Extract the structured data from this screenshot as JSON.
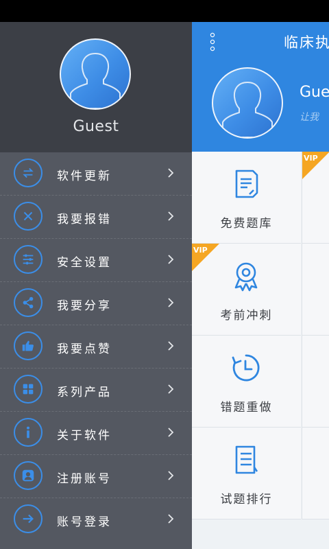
{
  "drawer": {
    "user_name": "Guest",
    "items": [
      {
        "label": "软件更新",
        "icon": "refresh-arrows-icon"
      },
      {
        "label": "我要报错",
        "icon": "close-icon"
      },
      {
        "label": "安全设置",
        "icon": "sliders-icon"
      },
      {
        "label": "我要分享",
        "icon": "share-icon"
      },
      {
        "label": "我要点赞",
        "icon": "thumbs-up-icon"
      },
      {
        "label": "系列产品",
        "icon": "grid-icon"
      },
      {
        "label": "关于软件",
        "icon": "info-icon"
      },
      {
        "label": "注册账号",
        "icon": "user-icon"
      },
      {
        "label": "账号登录",
        "icon": "login-arrow-icon"
      }
    ]
  },
  "main": {
    "title": "临床执",
    "user_name": "Gue",
    "slogan": "让我",
    "tiles": [
      {
        "label": "免费题库",
        "vip": "",
        "icon": "document-icon"
      },
      {
        "label": "考前冲刺",
        "vip": "VIP",
        "icon": "award-icon"
      },
      {
        "label": "错题重做",
        "vip": "",
        "icon": "clock-icon"
      },
      {
        "label": "试题排行",
        "vip": "",
        "icon": "list-icon"
      }
    ],
    "col2_vip": "VIP"
  },
  "colors": {
    "accent": "#2f86e0",
    "drawer_bg": "#545861",
    "drawer_header": "#3c3f46",
    "vip_badge": "#f5a623"
  }
}
